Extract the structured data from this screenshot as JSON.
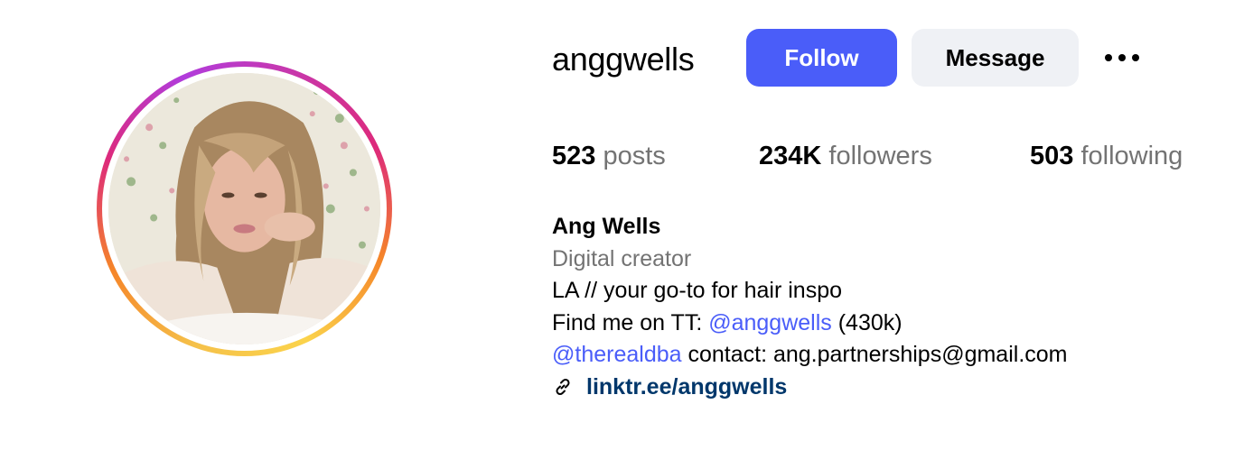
{
  "profile": {
    "username": "anggwells",
    "follow_label": "Follow",
    "message_label": "Message",
    "more_icon": "more-horizontal-icon",
    "avatar_icon": "avatar"
  },
  "stats": {
    "posts": {
      "count": "523",
      "label": "posts"
    },
    "followers": {
      "count": "234K",
      "label": "followers"
    },
    "following": {
      "count": "503",
      "label": "following"
    }
  },
  "bio": {
    "full_name": "Ang Wells",
    "category": "Digital creator",
    "line1": "LA // your go-to for hair inspo",
    "line2_prefix": "Find me on TT: ",
    "line2_mention": "@anggwells",
    "line2_suffix": " (430k)",
    "line3_mention": "@therealdba",
    "line3_suffix": " contact: ang.partnerships@gmail.com",
    "link_icon": "link-icon",
    "link_text": "linktr.ee/anggwells"
  },
  "colors": {
    "follow_button": "#4a5df9",
    "message_button": "#eff1f5",
    "mention": "#4a5df9",
    "link": "#00376b",
    "secondary_text": "#737373"
  }
}
